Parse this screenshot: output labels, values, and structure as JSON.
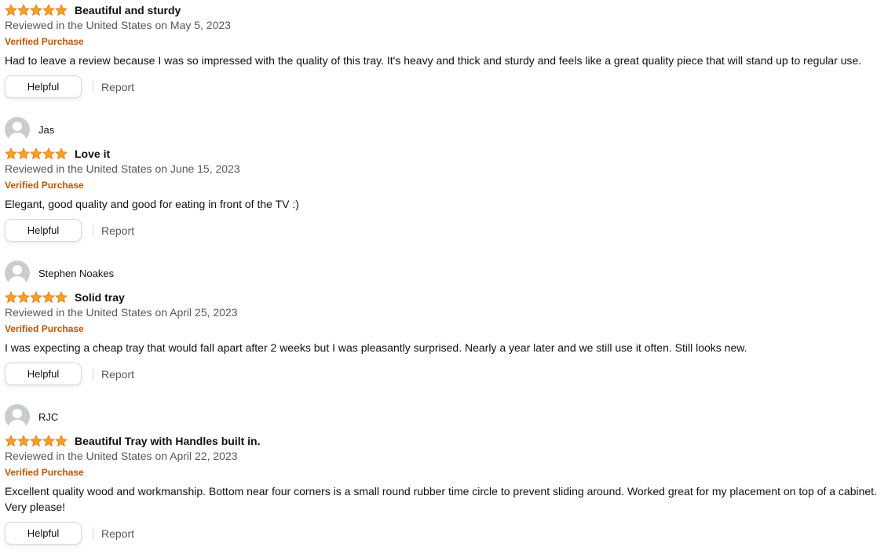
{
  "colors": {
    "star_fill": "#f7a021",
    "star_stroke": "#de7921",
    "verified": "#c45500",
    "meta_text": "#565959",
    "primary_text": "#0f1111"
  },
  "reviews": [
    {
      "reviewer_name": "",
      "rating": 5,
      "title": "Beautiful and sturdy",
      "date": "Reviewed in the United States on May 5, 2023",
      "verified_label": "Verified Purchase",
      "body": "Had to leave a review because I was so impressed with the quality of this tray. It's heavy and thick and sturdy and feels like a great quality piece that will stand up to regular use.",
      "helpful_label": "Helpful",
      "report_label": "Report"
    },
    {
      "reviewer_name": "Jas",
      "rating": 5,
      "title": "Love it",
      "date": "Reviewed in the United States on June 15, 2023",
      "verified_label": "Verified Purchase",
      "body": "Elegant, good quality and good for eating in front of the TV :)",
      "helpful_label": "Helpful",
      "report_label": "Report"
    },
    {
      "reviewer_name": "Stephen Noakes",
      "rating": 5,
      "title": "Solid tray",
      "date": "Reviewed in the United States on April 25, 2023",
      "verified_label": "Verified Purchase",
      "body": "I was expecting a cheap tray that would fall apart after 2 weeks but I was pleasantly surprised. Nearly a year later and we still use it often. Still looks new.",
      "helpful_label": "Helpful",
      "report_label": "Report"
    },
    {
      "reviewer_name": "RJC",
      "rating": 5,
      "title": "Beautiful Tray with Handles built in.",
      "date": "Reviewed in the United States on April 22, 2023",
      "verified_label": "Verified Purchase",
      "body": "Excellent quality wood and workmanship. Bottom near four corners is a small round rubber time circle to prevent sliding around. Worked great for my placement on top of a cabinet. Very please!",
      "helpful_label": "Helpful",
      "report_label": "Report"
    }
  ]
}
